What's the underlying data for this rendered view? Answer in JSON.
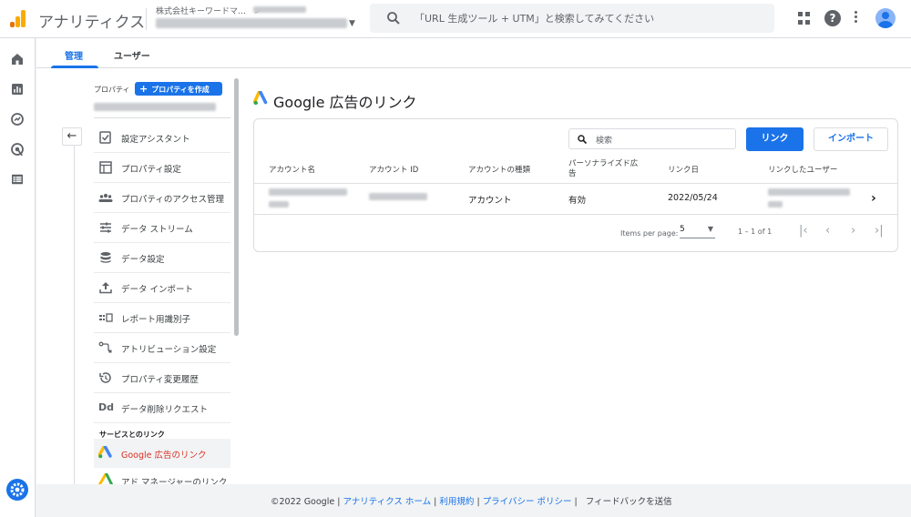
{
  "app": {
    "title": "アナリティクス"
  },
  "account": {
    "org_name": "株式会社キーワードマ…",
    "separator": ">"
  },
  "search": {
    "placeholder": "「URL 生成ツール + UTM」と検索してみてください"
  },
  "tabs": [
    {
      "label": "管理",
      "active": true
    },
    {
      "label": "ユーザー",
      "active": false
    }
  ],
  "property": {
    "label": "プロパティ",
    "create_button": "プロパティを作成"
  },
  "menu": [
    {
      "label": "設定アシスタント",
      "icon": "checklist-icon"
    },
    {
      "label": "プロパティ設定",
      "icon": "layout-icon"
    },
    {
      "label": "プロパティのアクセス管理",
      "icon": "people-icon"
    },
    {
      "label": "データ ストリーム",
      "icon": "streams-icon"
    },
    {
      "label": "データ設定",
      "icon": "database-icon"
    },
    {
      "label": "データ インポート",
      "icon": "upload-icon"
    },
    {
      "label": "レポート用識別子",
      "icon": "identity-icon"
    },
    {
      "label": "アトリビューション設定",
      "icon": "attribution-icon"
    },
    {
      "label": "プロパティ変更履歴",
      "icon": "history-icon"
    },
    {
      "label": "データ削除リクエスト",
      "icon": "dd-icon",
      "glyph": "Dd"
    }
  ],
  "links_section": {
    "heading": "サービスとのリンク",
    "items": [
      {
        "label": "Google 広告のリンク",
        "selected": true
      },
      {
        "label": "アド マネージャーのリンク",
        "selected": false
      }
    ]
  },
  "page": {
    "title": "Google 広告のリンク"
  },
  "table": {
    "search_placeholder": "検索",
    "link_button": "リンク",
    "import_button": "インポート",
    "headers": [
      "アカウント名",
      "アカウント ID",
      "アカウントの種類",
      "パーソナライズド広告",
      "リンク日",
      "リンクしたユーザー"
    ],
    "rows": [
      {
        "account_type": "アカウント",
        "personalized": "有効",
        "link_date": "2022/05/24"
      }
    ]
  },
  "pagination": {
    "items_per_page_label": "Items per page:",
    "items_per_page": "5",
    "range": "1 – 1 of 1"
  },
  "footer": {
    "copyright": "©2022 Google",
    "links": [
      "アナリティクス ホーム",
      "利用規約",
      "プライバシー ポリシー"
    ],
    "feedback": "フィードバックを送信"
  },
  "colors": {
    "accent": "#1a73e8",
    "selected_text": "#d93025",
    "logo_orange": "#f9ab00",
    "logo_dark_orange": "#e37400"
  }
}
